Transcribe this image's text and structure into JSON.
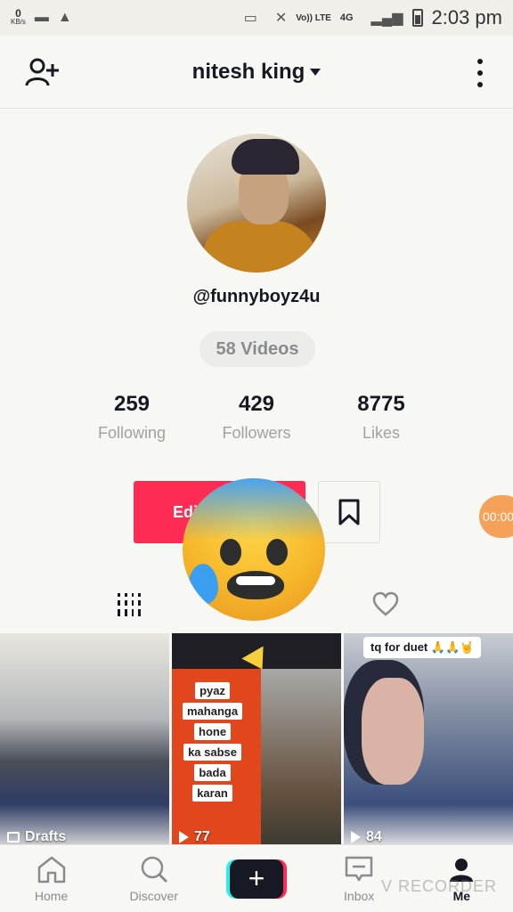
{
  "status_bar": {
    "net_speed_value": "0",
    "net_speed_unit": "KB/s",
    "network": "4G",
    "volte": "Vo)) LTE",
    "time": "2:03 pm"
  },
  "header": {
    "title": "nitesh king",
    "add_user_icon": "person-add-icon",
    "more_icon": "more-vertical-icon"
  },
  "profile": {
    "handle": "@funnyboyz4u",
    "videos_label": "58 Videos",
    "stats": [
      {
        "value": "259",
        "label": "Following"
      },
      {
        "value": "429",
        "label": "Followers"
      },
      {
        "value": "8775",
        "label": "Likes"
      }
    ],
    "edit_label": "Edi",
    "bookmark_icon": "bookmark-icon",
    "overlay_emoji": "anxious-face-with-sweat-emoji",
    "recorder_bubble": "00:00"
  },
  "tabs": {
    "grid_icon": "grid-icon",
    "liked_icon": "heart-icon"
  },
  "videos": [
    {
      "label": "Drafts",
      "type": "drafts"
    },
    {
      "label": "77",
      "type": "plays",
      "overlay_lines": [
        "pyaz",
        "mahanga",
        "hone",
        "ka sabse",
        "bada",
        "karan"
      ]
    },
    {
      "label": "84",
      "type": "plays",
      "caption": "tq for duet 🙏🙏🤘"
    }
  ],
  "bottom_nav": {
    "items": [
      {
        "label": "Home",
        "icon": "home-icon"
      },
      {
        "label": "Discover",
        "icon": "search-icon"
      },
      {
        "label": "+",
        "icon": "create-icon"
      },
      {
        "label": "Inbox",
        "icon": "inbox-icon"
      },
      {
        "label": "Me",
        "icon": "profile-icon"
      }
    ],
    "watermark": "V RECORDER"
  },
  "colors": {
    "accent": "#fe2c55",
    "cyan": "#2af0ea",
    "text": "#161823",
    "muted": "#a0a1a6"
  }
}
